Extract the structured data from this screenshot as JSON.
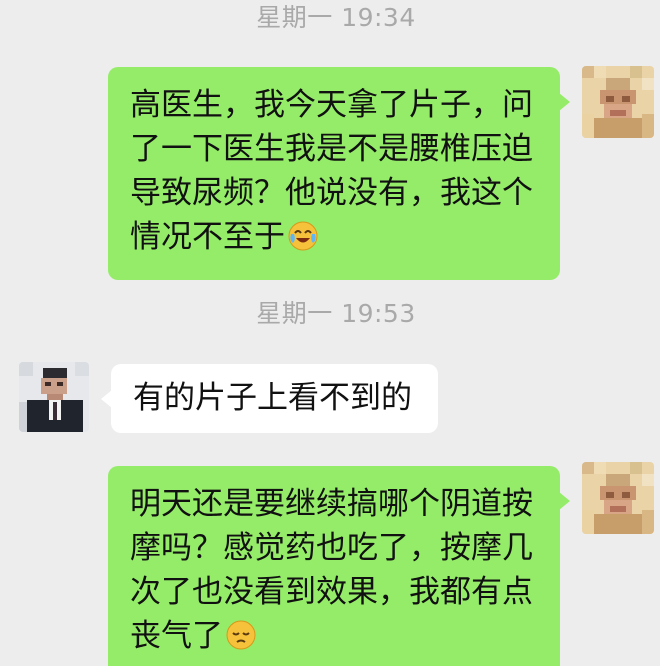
{
  "chat": {
    "messages_group_1": {
      "timestamp": "星期一 19:34",
      "outgoing_text": "高医生，我今天拿了片子，问了一下医生我是不是腰椎压迫导致尿频？他说没有，我这个情况不至于",
      "outgoing_emoji": "crying-laughing-emoji"
    },
    "messages_group_2": {
      "timestamp": "星期一 19:53",
      "incoming_text": "有的片子上看不到的",
      "outgoing_text": "明天还是要继续搞哪个阴道按摩吗？感觉药也吃了，按摩几次了也没看到效果，我都有点丧气了",
      "outgoing_emoji": "pensive-face-emoji"
    }
  },
  "colors": {
    "background": "#ededed",
    "outgoing_bubble": "#95ec69",
    "incoming_bubble": "#ffffff",
    "timestamp_text": "#a9a9a9"
  }
}
